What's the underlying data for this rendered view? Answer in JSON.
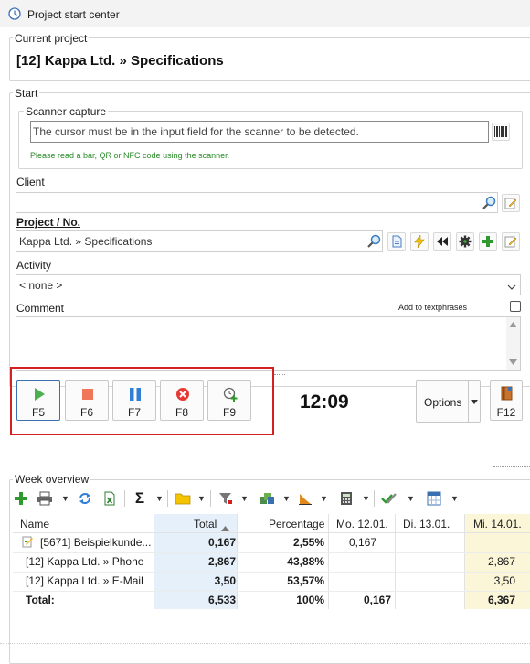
{
  "window": {
    "title": "Project start center"
  },
  "current_project": {
    "legend": "Current project",
    "name": "[12] Kappa Ltd. » Specifications"
  },
  "start": {
    "legend": "Start",
    "scanner": {
      "legend": "Scanner capture",
      "placeholder": "The cursor must be in the input field for the scanner to be detected.",
      "hint": "Please read a bar, QR or NFC code using the scanner."
    },
    "client": {
      "label": "Client",
      "value": ""
    },
    "project": {
      "label": "Project / No.",
      "value": "Kappa Ltd. » Specifications"
    },
    "activity": {
      "label": "Activity",
      "value": "< none >"
    },
    "comment": {
      "label": "Comment",
      "add_textphrases": "Add to textphrases",
      "value": ""
    }
  },
  "timer": {
    "buttons": [
      {
        "key": "F5",
        "action": "start"
      },
      {
        "key": "F6",
        "action": "stop"
      },
      {
        "key": "F7",
        "action": "pause"
      },
      {
        "key": "F8",
        "action": "cancel"
      },
      {
        "key": "F9",
        "action": "add-time"
      }
    ],
    "time": "12:09",
    "options_label": "Options",
    "f12_label": "F12"
  },
  "week_overview": {
    "legend": "Week overview",
    "columns": [
      "Name",
      "Total",
      "Percentage",
      "Mo. 12.01.",
      "Di. 13.01.",
      "Mi. 14.01."
    ],
    "rows": [
      {
        "name": "[5671] Beispielkunde...",
        "total": "0,167",
        "percentage": "2,55%",
        "mo": "0,167",
        "di": "",
        "mi": ""
      },
      {
        "name": "[12] Kappa Ltd. » Phone",
        "total": "2,867",
        "percentage": "43,88%",
        "mo": "",
        "di": "",
        "mi": "2,867"
      },
      {
        "name": "[12] Kappa Ltd. » E-Mail",
        "total": "3,50",
        "percentage": "53,57%",
        "mo": "",
        "di": "",
        "mi": "3,50"
      }
    ],
    "total_row": {
      "name": "Total:",
      "total": "6,533",
      "percentage": "100%",
      "mo": "0,167",
      "di": "",
      "mi": "6,367"
    }
  },
  "colors": {
    "highlight_red": "#d42020",
    "play_green": "#4caf50",
    "stop_red": "#f0765a",
    "pause_blue": "#2f7fd6",
    "total_col_bg": "#e6f0fb",
    "today_col_bg": "#fcf6d9"
  }
}
